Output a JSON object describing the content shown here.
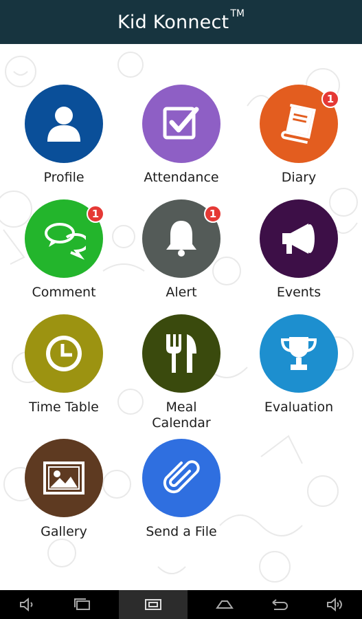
{
  "app": {
    "title": "Kid Konnect",
    "trademark": "TM"
  },
  "colors": {
    "header_bg": "#17343f",
    "profile": "#0a4f99",
    "attendance": "#8e5fc5",
    "diary": "#e35d1f",
    "comment": "#23b52c",
    "alert": "#545b58",
    "events": "#3d0f47",
    "timetable": "#9c9311",
    "meal": "#3a4a0d",
    "evaluation": "#1d8fcf",
    "gallery": "#5e3a21",
    "sendfile": "#2f6fe0",
    "badge": "#e53935"
  },
  "tiles": [
    {
      "label": "Profile",
      "icon": "user-icon",
      "badge": null
    },
    {
      "label": "Attendance",
      "icon": "checkbox-icon",
      "badge": null
    },
    {
      "label": "Diary",
      "icon": "book-icon",
      "badge": "1"
    },
    {
      "label": "Comment",
      "icon": "chat-bubbles-icon",
      "badge": "1"
    },
    {
      "label": "Alert",
      "icon": "bell-icon",
      "badge": "1"
    },
    {
      "label": "Events",
      "icon": "megaphone-icon",
      "badge": null
    },
    {
      "label": "Time Table",
      "icon": "clock-icon",
      "badge": null
    },
    {
      "label": "Meal\nCalendar",
      "icon": "fork-knife-icon",
      "badge": null
    },
    {
      "label": "Evaluation",
      "icon": "trophy-icon",
      "badge": null
    },
    {
      "label": "Gallery",
      "icon": "picture-icon",
      "badge": null
    },
    {
      "label": "Send a File",
      "icon": "paperclip-icon",
      "badge": null
    }
  ],
  "navbar": [
    "volume-down-icon",
    "recent-apps-icon",
    "screenshot-icon",
    "home-icon",
    "back-icon",
    "volume-up-icon"
  ]
}
